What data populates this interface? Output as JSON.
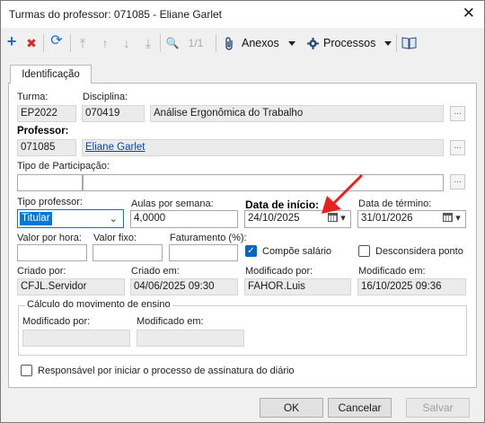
{
  "window": {
    "title": "Turmas do professor: 071085 - Eliane Garlet",
    "close_symbol": "✕"
  },
  "toolbar": {
    "add_symbol": "+",
    "delete_symbol": "✖",
    "refresh_symbol": "⟳",
    "first_symbol": "⤒",
    "prev_symbol": "↑",
    "next_symbol": "↓",
    "last_symbol": "⤓",
    "search_symbol": "🔍",
    "record_counter": "1/1",
    "attachments_label": "Anexos",
    "processes_label": "Processos"
  },
  "tabs": [
    {
      "label": "Identificação"
    }
  ],
  "form": {
    "turma": {
      "label": "Turma:",
      "value": "EP2022"
    },
    "disciplina": {
      "label": "Disciplina:",
      "code": "070419",
      "name": "Análise Ergonômica do Trabalho"
    },
    "professor": {
      "label": "Professor:",
      "code": "071085",
      "name": "Eliane Garlet"
    },
    "tipo_participacao": {
      "label": "Tipo de Participação:",
      "value": ""
    },
    "tipo_professor": {
      "label": "Tipo professor:",
      "value": "Titular"
    },
    "aulas_semana": {
      "label": "Aulas por semana:",
      "value": "4,0000"
    },
    "data_inicio": {
      "label": "Data de início:",
      "value": "24/10/2025"
    },
    "data_termino": {
      "label": "Data de término:",
      "value": "31/01/2026"
    },
    "valor_hora": {
      "label": "Valor por hora:",
      "value": ""
    },
    "valor_fixo": {
      "label": "Valor fixo:",
      "value": ""
    },
    "faturamento": {
      "label": "Faturamento (%):",
      "value": ""
    },
    "compoe_salario": {
      "label": "Compõe salário",
      "checked": true
    },
    "desconsidera_ponto": {
      "label": "Desconsidera ponto",
      "checked": false
    },
    "criado_por": {
      "label": "Criado por:",
      "value": "CFJL.Servidor"
    },
    "criado_em": {
      "label": "Criado em:",
      "value": "04/06/2025 09:30"
    },
    "modificado_por": {
      "label": "Modificado por:",
      "value": "FAHOR.Luis"
    },
    "modificado_em": {
      "label": "Modificado em:",
      "value": "16/10/2025 09:36"
    },
    "calculo": {
      "title": "Cálculo do movimento de ensino",
      "modificado_por_label": "Modificado por:",
      "modificado_por_value": "",
      "modificado_em_label": "Modificado em:",
      "modificado_em_value": ""
    },
    "responsavel": {
      "label": "Responsável por iniciar o processo de assinatura do diário",
      "checked": false
    },
    "ellipsis": "..."
  },
  "buttons": {
    "ok": "OK",
    "cancel": "Cancelar",
    "save": "Salvar"
  },
  "colors": {
    "accent": "#0078d7",
    "link": "#0645ad",
    "annotation_arrow": "#e8201e"
  }
}
